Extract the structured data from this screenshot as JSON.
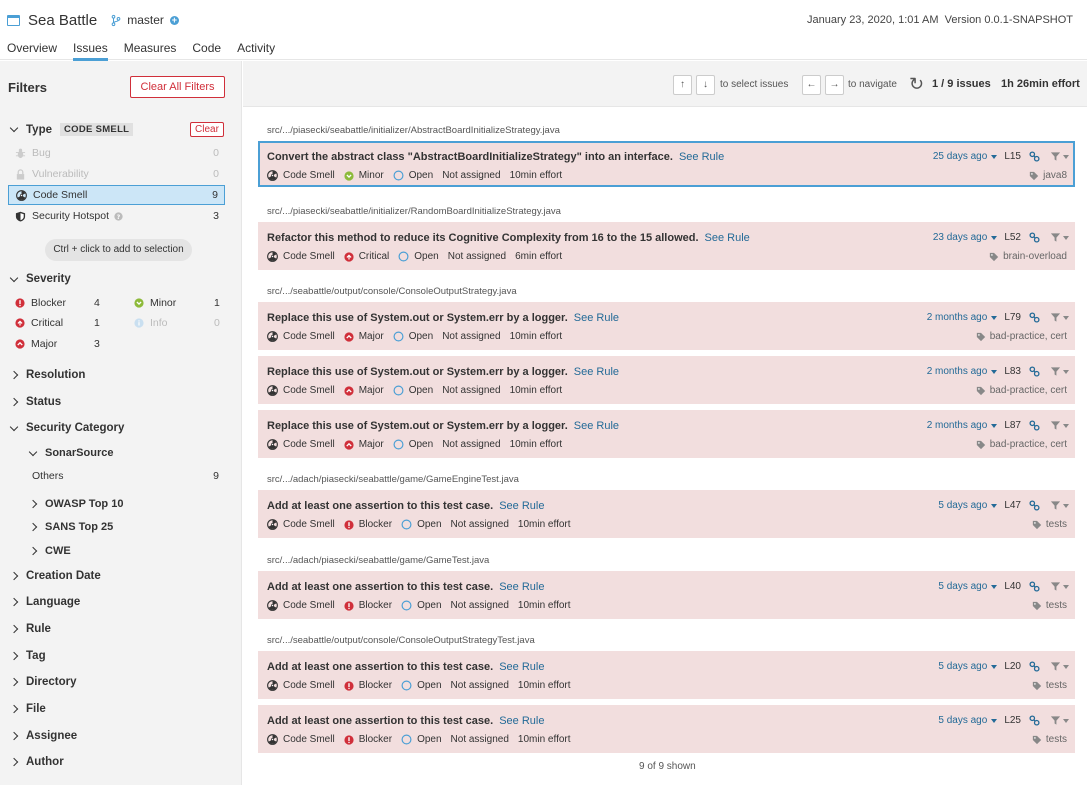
{
  "header": {
    "project_name": "Sea Battle",
    "branch": "master",
    "plus_glyph": "+",
    "date": "January 23, 2020, 1:01 AM",
    "version": "Version 0.0.1-SNAPSHOT"
  },
  "nav": {
    "tabs": [
      "Overview",
      "Issues",
      "Measures",
      "Code",
      "Activity"
    ],
    "active": "Issues"
  },
  "filters": {
    "title": "Filters",
    "clear_all": "Clear All Filters",
    "type": {
      "title": "Type",
      "tag": "CODE SMELL",
      "clear": "Clear",
      "items": [
        {
          "label": "Bug",
          "count": "0",
          "icon": "bug-icon"
        },
        {
          "label": "Vulnerability",
          "count": "0",
          "icon": "lock-icon"
        },
        {
          "label": "Code Smell",
          "count": "9",
          "icon": "radiation-icon"
        },
        {
          "label": "Security Hotspot",
          "count": "3",
          "icon": "shield-icon"
        }
      ]
    },
    "ctrl_hint": "Ctrl + click to add to selection",
    "severity": {
      "title": "Severity",
      "items": [
        {
          "label": "Blocker",
          "count": "4"
        },
        {
          "label": "Minor",
          "count": "1"
        },
        {
          "label": "Critical",
          "count": "1"
        },
        {
          "label": "Info",
          "count": "0"
        },
        {
          "label": "Major",
          "count": "3"
        }
      ]
    },
    "resolution": "Resolution",
    "status": "Status",
    "security_category": {
      "title": "Security Category",
      "sonarsource": "SonarSource",
      "others": "Others",
      "others_count": "9",
      "owasp": "OWASP Top 10",
      "sans": "SANS Top 25",
      "cwe": "CWE"
    },
    "more": [
      "Creation Date",
      "Language",
      "Rule",
      "Tag",
      "Directory",
      "File",
      "Assignee",
      "Author"
    ]
  },
  "toolbar": {
    "up": "↑",
    "down": "↓",
    "select_text": "to select issues",
    "left": "←",
    "right": "→",
    "navigate_text": "to navigate",
    "reload": "↻",
    "page_count": "1 / 9 issues",
    "effort": "1h 26min effort"
  },
  "issues": {
    "see_rule": "See Rule",
    "type": "Code Smell",
    "status": "Open",
    "assignee": "Not assigned",
    "files": [
      {
        "path": "src/.../piasecki/seabattle/initializer/AbstractBoardInitializeStrategy.java"
      },
      {
        "path": "src/.../piasecki/seabattle/initializer/RandomBoardInitializeStrategy.java"
      },
      {
        "path": "src/.../seabattle/output/console/ConsoleOutputStrategy.java"
      },
      {
        "path": "src/.../adach/piasecki/seabattle/game/GameEngineTest.java"
      },
      {
        "path": "src/.../adach/piasecki/seabattle/game/GameTest.java"
      },
      {
        "path": "src/.../seabattle/output/console/ConsoleOutputStrategyTest.java"
      }
    ],
    "list": [
      {
        "title": "Convert the abstract class \"AbstractBoardInitializeStrategy\" into an interface.",
        "severity": "Minor",
        "effort": "10min effort",
        "age": "25 days ago",
        "line": "L15",
        "tags": "java8"
      },
      {
        "title": "Refactor this method to reduce its Cognitive Complexity from 16 to the 15 allowed.",
        "severity": "Critical",
        "effort": "6min effort",
        "age": "23 days ago",
        "line": "L52",
        "tags": "brain-overload"
      },
      {
        "title": "Replace this use of System.out or System.err by a logger.",
        "severity": "Major",
        "effort": "10min effort",
        "age": "2 months ago",
        "line": "L79",
        "tags": "bad-practice, cert"
      },
      {
        "title": "Replace this use of System.out or System.err by a logger.",
        "severity": "Major",
        "effort": "10min effort",
        "age": "2 months ago",
        "line": "L83",
        "tags": "bad-practice, cert"
      },
      {
        "title": "Replace this use of System.out or System.err by a logger.",
        "severity": "Major",
        "effort": "10min effort",
        "age": "2 months ago",
        "line": "L87",
        "tags": "bad-practice, cert"
      },
      {
        "title": "Add at least one assertion to this test case.",
        "severity": "Blocker",
        "effort": "10min effort",
        "age": "5 days ago",
        "line": "L47",
        "tags": "tests"
      },
      {
        "title": "Add at least one assertion to this test case.",
        "severity": "Blocker",
        "effort": "10min effort",
        "age": "5 days ago",
        "line": "L40",
        "tags": "tests"
      },
      {
        "title": "Add at least one assertion to this test case.",
        "severity": "Blocker",
        "effort": "10min effort",
        "age": "5 days ago",
        "line": "L20",
        "tags": "tests"
      },
      {
        "title": "Add at least one assertion to this test case.",
        "severity": "Blocker",
        "effort": "10min effort",
        "age": "5 days ago",
        "line": "L25",
        "tags": "tests"
      }
    ],
    "shown": "9 of 9 shown"
  },
  "colors": {
    "accent": "#4b9fd5",
    "link": "#236a97",
    "danger": "#d02f3a",
    "issue_bg": "#f2dede",
    "minor": "#8dba3a"
  }
}
